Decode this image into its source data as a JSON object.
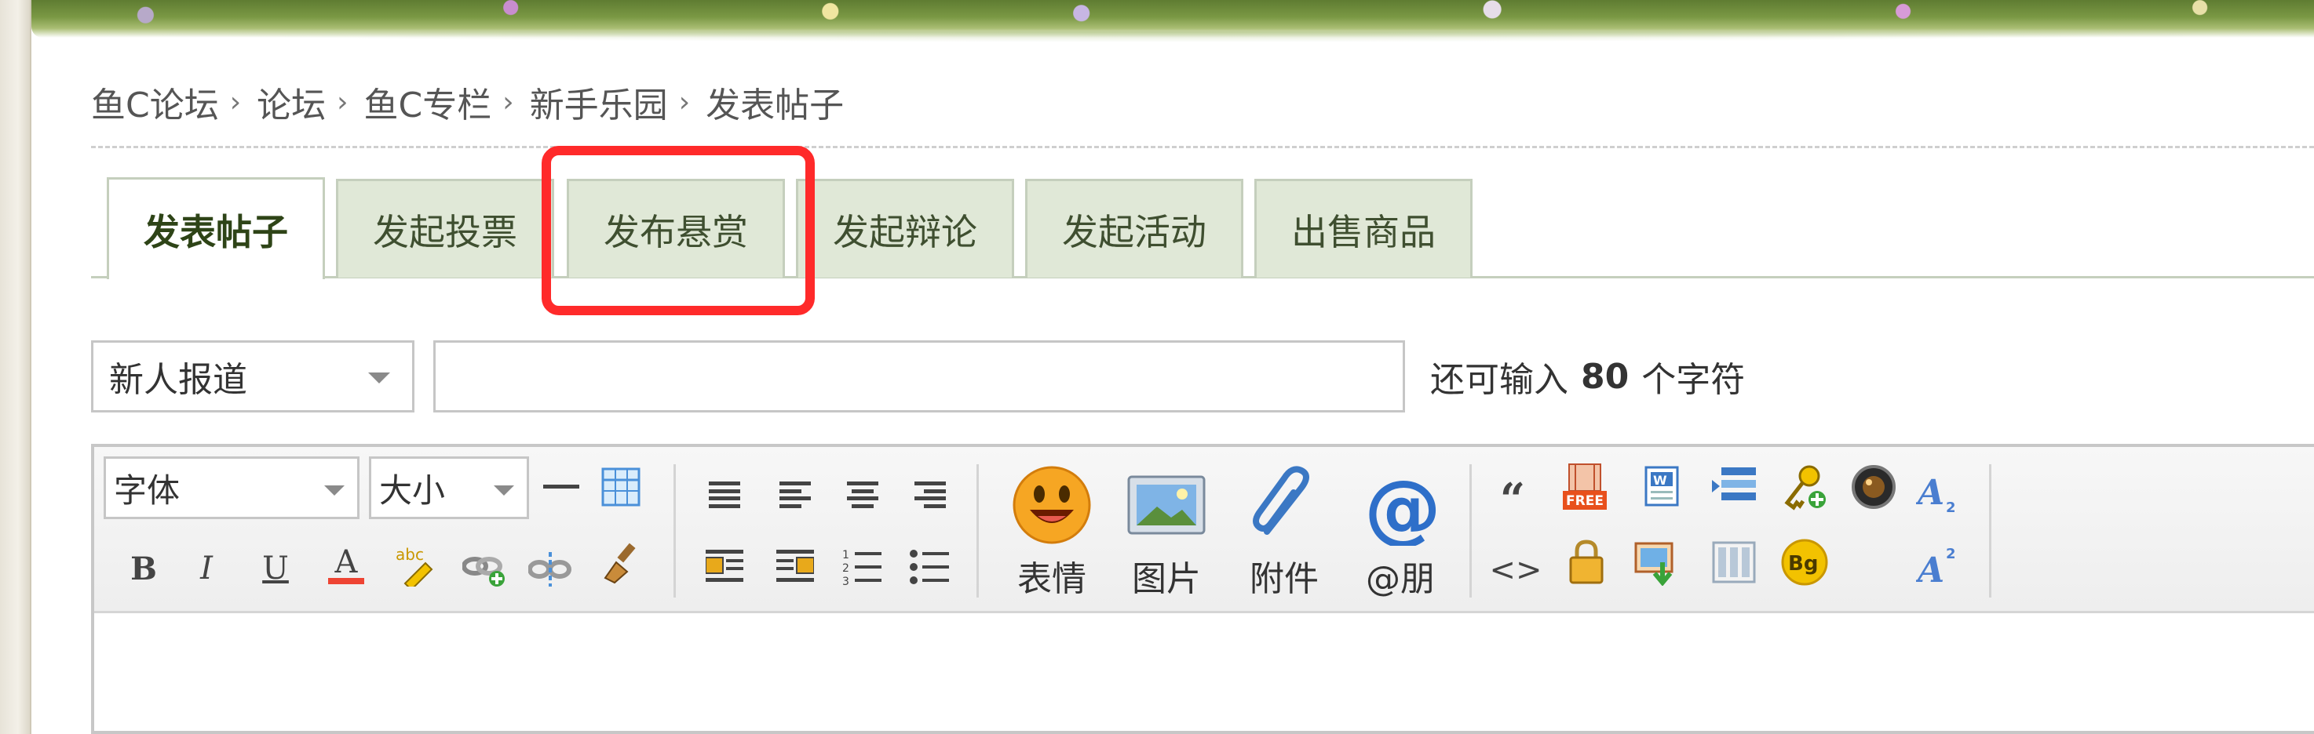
{
  "breadcrumb": {
    "items": [
      "鱼C论坛",
      "论坛",
      "鱼C专栏",
      "新手乐园",
      "发表帖子"
    ],
    "separator": "›"
  },
  "tabs": [
    {
      "label": "发表帖子",
      "active": true
    },
    {
      "label": "发起投票",
      "active": false
    },
    {
      "label": "发布悬赏",
      "active": false,
      "highlighted": true
    },
    {
      "label": "发起辩论",
      "active": false
    },
    {
      "label": "发起活动",
      "active": false
    },
    {
      "label": "出售商品",
      "active": false
    }
  ],
  "subject": {
    "type_select": "新人报道",
    "input_value": "",
    "remaining_prefix": "还可输入",
    "remaining_count": "80",
    "remaining_suffix": "个字符"
  },
  "toolbar": {
    "font_select": "字体",
    "size_select": "大小",
    "bold": "B",
    "italic": "I",
    "underline": "U",
    "font_color": "A",
    "quote": "“",
    "code": "<>",
    "big_tools": [
      "表情",
      "图片",
      "附件",
      "@朋"
    ],
    "free_badge": "FREE",
    "bg_badge": "Bg"
  },
  "colors": {
    "highlight": "#ff2a2a",
    "tab_bg": "#e0e8d7",
    "tab_text": "#3f4f30",
    "accent_blue": "#2e6fc9",
    "accent_orange": "#f0a020"
  }
}
